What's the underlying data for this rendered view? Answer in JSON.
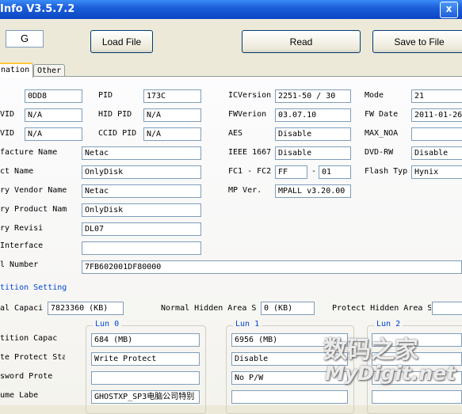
{
  "window": {
    "title": "Info V3.5.7.2",
    "close_glyph": "x"
  },
  "drive_letter": "G",
  "buttons": {
    "load": "Load File",
    "read": "Read",
    "save": "Save to File"
  },
  "tabs": {
    "active": "nation",
    "other": "Other"
  },
  "info": {
    "row1": {
      "label_pid": "PID",
      "vid_value": "0DD8",
      "pid_value": "173C"
    },
    "row2": {
      "label_vid": "VID",
      "label_hid_pid": "HID PID",
      "vid_value": "N/A",
      "pid_value": "N/A"
    },
    "row3": {
      "label_vid": "VID",
      "label_ccid_pid": "CCID PID",
      "vid_value": "N/A",
      "pid_value": "N/A"
    },
    "manufacture": {
      "label": "facture Name",
      "value": "Netac"
    },
    "product": {
      "label": "ct Name",
      "value": "OnlyDisk"
    },
    "inq_vendor": {
      "label": "ry Vendor Name",
      "value": "Netac"
    },
    "inq_product": {
      "label": "ry Product Name",
      "value": "OnlyDisk"
    },
    "inq_revision": {
      "label": "ry Revisi",
      "value": "DL07"
    },
    "interface": {
      "label": "Interface",
      "value": ""
    },
    "serial": {
      "label": "l Number",
      "value": "7FB602001DF80000"
    },
    "ic_version": {
      "label": "ICVersion",
      "value": "2251-50 / 30"
    },
    "fw_version": {
      "label": "FWVerion",
      "value": "03.07.10"
    },
    "aes": {
      "label": "AES",
      "value": "Disable"
    },
    "ieee": {
      "label": "IEEE 1667",
      "value": "Disable"
    },
    "fc": {
      "label": "FC1 - FC2",
      "fc1": "FF",
      "dash": "-",
      "fc2": "01"
    },
    "mp_ver": {
      "label": "MP Ver.",
      "value": "MPALL v3.20.00"
    },
    "mode": {
      "label": "Mode",
      "value": "21"
    },
    "fw_date": {
      "label": "FW Date",
      "value": "2011-01-26"
    },
    "max_noa": {
      "label": "MAX_NOA",
      "value": ""
    },
    "dvd_rw": {
      "label": "DVD-RW",
      "value": "Disable"
    },
    "flash_type": {
      "label": "Flash Typ",
      "value": "Hynix"
    }
  },
  "partition": {
    "section_title": "tition Setting",
    "normal_capacity": {
      "label": "al Capaci",
      "value": "7823360  (KB)"
    },
    "normal_hidden": {
      "label": "Normal Hidden Area S",
      "value": "0  (KB)"
    },
    "protect_hidden": {
      "label": "Protect Hidden Area S",
      "value": ""
    },
    "row_labels": {
      "capacity": "tition Capac",
      "write_protect": "te Protect Sta",
      "password": "sword Prote",
      "volume": "ume Labe"
    },
    "luns": [
      {
        "title": "Lun 0",
        "capacity": "684  (MB)",
        "write_protect": "Write Protect",
        "password": "",
        "volume": "GHOSTXP_SP3电脑公司特别"
      },
      {
        "title": "Lun 1",
        "capacity": "6956  (MB)",
        "write_protect": "Disable",
        "password": "No P/W",
        "volume": ""
      },
      {
        "title": "Lun 2",
        "capacity": "",
        "write_protect": "",
        "password": "",
        "volume": ""
      }
    ]
  },
  "watermark": {
    "line1": "数码之家",
    "line2": "MyDigit.net"
  }
}
